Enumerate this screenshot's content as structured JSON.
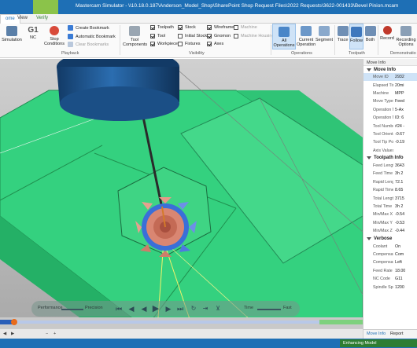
{
  "window": {
    "title": "Mastercam Simulator - \\\\10.18.0.187\\Anderson_Model_Shop\\SharePoint Shop Request Files\\2022 Requests\\3622-001433\\Bevel Pinion.mcam",
    "context_tab": "Verify"
  },
  "tabs": [
    "ome",
    "View",
    "Verify"
  ],
  "ribbon": {
    "simulation": "Simulation",
    "nc": "NC",
    "nc_code": "G1",
    "stop_conditions": "Stop Conditions",
    "create_bookmark": "Create Bookmark",
    "automatic_bookmark": "Automatic Bookmark",
    "clear_bookmarks": "Clear Bookmarks",
    "playback_group": "Playback",
    "tool_components": "Tool Components",
    "visibility_items": [
      {
        "label": "Toolpath",
        "on": true
      },
      {
        "label": "Tool",
        "on": true
      },
      {
        "label": "Workpiece",
        "on": true
      },
      {
        "label": "Stock",
        "on": true
      },
      {
        "label": "Initial Stock",
        "on": false
      },
      {
        "label": "Fixtures",
        "on": false
      },
      {
        "label": "Wireframe",
        "on": true
      },
      {
        "label": "Gnomon",
        "on": true
      },
      {
        "label": "Axes",
        "on": true
      },
      {
        "label": "Machine",
        "on": false
      },
      {
        "label": "Machine Housing",
        "on": false
      }
    ],
    "visibility_group": "Visibility",
    "all_operations": "All Operations",
    "current_operation": "Current Operation",
    "segment": "Segment",
    "operations_group": "Operations",
    "trace": "Trace",
    "follow": "Follow",
    "both": "Both",
    "toolpath_group": "Toolpath",
    "record": "Record",
    "recording_options": "Recording Options",
    "demonstration_group": "Demonstratio"
  },
  "playback": {
    "performance": "Performance",
    "precision": "Precision",
    "time": "Time",
    "fast": "Fast",
    "progress": 0.04
  },
  "panel": {
    "header": "Move Info",
    "move_info_title": "Move Info",
    "move_info": [
      {
        "k": "Move ID",
        "v": "2932"
      },
      {
        "k": "Elapsed Time",
        "v": "20mi"
      },
      {
        "k": "Machine",
        "v": "MPP"
      },
      {
        "k": "Move Type",
        "v": "Feed"
      },
      {
        "k": "Operation Name",
        "v": "5-Ax"
      },
      {
        "k": "Operation Nu...",
        "v": "ID: 6"
      },
      {
        "k": "Tool Number",
        "v": "#24 -"
      },
      {
        "k": "Tool Orientation",
        "v": "-0.67"
      },
      {
        "k": "Tool Tip Position",
        "v": "-0.19"
      },
      {
        "k": "Axis Values",
        "v": ""
      }
    ],
    "toolpath_info_title": "Toolpath Info",
    "toolpath_info": [
      {
        "k": "Feed Length",
        "v": "3643"
      },
      {
        "k": "Feed Time",
        "v": "3h 2"
      },
      {
        "k": "Rapid Length",
        "v": "72.1"
      },
      {
        "k": "Rapid Time",
        "v": "8.65"
      },
      {
        "k": "Total Length",
        "v": "3715"
      },
      {
        "k": "Total Time",
        "v": "3h 2"
      },
      {
        "k": "Min/Max X",
        "v": "-0.54"
      },
      {
        "k": "Min/Max Y",
        "v": "-0.53"
      },
      {
        "k": "Min/Max Z",
        "v": "-0.44"
      }
    ],
    "verbose_title": "Verbose",
    "verbose": [
      {
        "k": "Coolant",
        "v": "On"
      },
      {
        "k": "Compensation...",
        "v": "Com"
      },
      {
        "k": "Compensation...",
        "v": "Left"
      },
      {
        "k": "Feed Rate",
        "v": "18.00"
      },
      {
        "k": "NC Code",
        "v": "G11"
      },
      {
        "k": "Spindle Speed",
        "v": "1200"
      }
    ],
    "tab_move_info": "Move Info",
    "tab_report": "Report"
  },
  "status": {
    "enhancing_model": "Enhancing Model"
  },
  "colors": {
    "accent": "#1e6fb5",
    "stock_green": "#3ddc84",
    "tool_blue": "#1f5f9e"
  }
}
